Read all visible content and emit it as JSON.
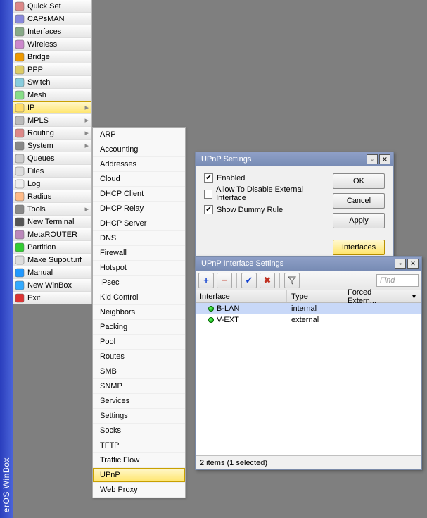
{
  "app_title_vertical": "erOS WinBox",
  "main_menu": [
    {
      "label": "Quick Set",
      "arrow": false
    },
    {
      "label": "CAPsMAN",
      "arrow": false
    },
    {
      "label": "Interfaces",
      "arrow": false
    },
    {
      "label": "Wireless",
      "arrow": false
    },
    {
      "label": "Bridge",
      "arrow": false
    },
    {
      "label": "PPP",
      "arrow": false
    },
    {
      "label": "Switch",
      "arrow": false
    },
    {
      "label": "Mesh",
      "arrow": false
    },
    {
      "label": "IP",
      "arrow": true,
      "highlight": true
    },
    {
      "label": "MPLS",
      "arrow": true
    },
    {
      "label": "Routing",
      "arrow": true
    },
    {
      "label": "System",
      "arrow": true
    },
    {
      "label": "Queues",
      "arrow": false
    },
    {
      "label": "Files",
      "arrow": false
    },
    {
      "label": "Log",
      "arrow": false
    },
    {
      "label": "Radius",
      "arrow": false
    },
    {
      "label": "Tools",
      "arrow": true
    },
    {
      "label": "New Terminal",
      "arrow": false
    },
    {
      "label": "MetaROUTER",
      "arrow": false
    },
    {
      "label": "Partition",
      "arrow": false
    },
    {
      "label": "Make Supout.rif",
      "arrow": false
    },
    {
      "label": "Manual",
      "arrow": false
    },
    {
      "label": "New WinBox",
      "arrow": false
    },
    {
      "label": "Exit",
      "arrow": false
    }
  ],
  "submenu_ip": [
    "ARP",
    "Accounting",
    "Addresses",
    "Cloud",
    "DHCP Client",
    "DHCP Relay",
    "DHCP Server",
    "DNS",
    "Firewall",
    "Hotspot",
    "IPsec",
    "Kid Control",
    "Neighbors",
    "Packing",
    "Pool",
    "Routes",
    "SMB",
    "SNMP",
    "Services",
    "Settings",
    "Socks",
    "TFTP",
    "Traffic Flow",
    "UPnP",
    "Web Proxy"
  ],
  "submenu_highlight": "UPnP",
  "upnp_settings": {
    "title": "UPnP Settings",
    "enabled": {
      "label": "Enabled",
      "checked": true
    },
    "allow_disable": {
      "label": "Allow To Disable External Interface",
      "checked": false
    },
    "show_dummy": {
      "label": "Show Dummy Rule",
      "checked": true
    },
    "buttons": {
      "ok": "OK",
      "cancel": "Cancel",
      "apply": "Apply",
      "interfaces": "Interfaces"
    }
  },
  "upnp_interfaces": {
    "title": "UPnP Interface Settings",
    "find_placeholder": "Find",
    "columns": [
      "Interface",
      "Type",
      "Forced Extern..."
    ],
    "rows": [
      {
        "interface": "B-LAN",
        "type": "internal",
        "selected": true
      },
      {
        "interface": "V-EXT",
        "type": "external",
        "selected": false
      }
    ],
    "status": "2 items (1 selected)"
  },
  "icons": {
    "add": "+",
    "remove": "−",
    "enable": "✔",
    "disable": "✖",
    "filter_funnel": "▼"
  }
}
